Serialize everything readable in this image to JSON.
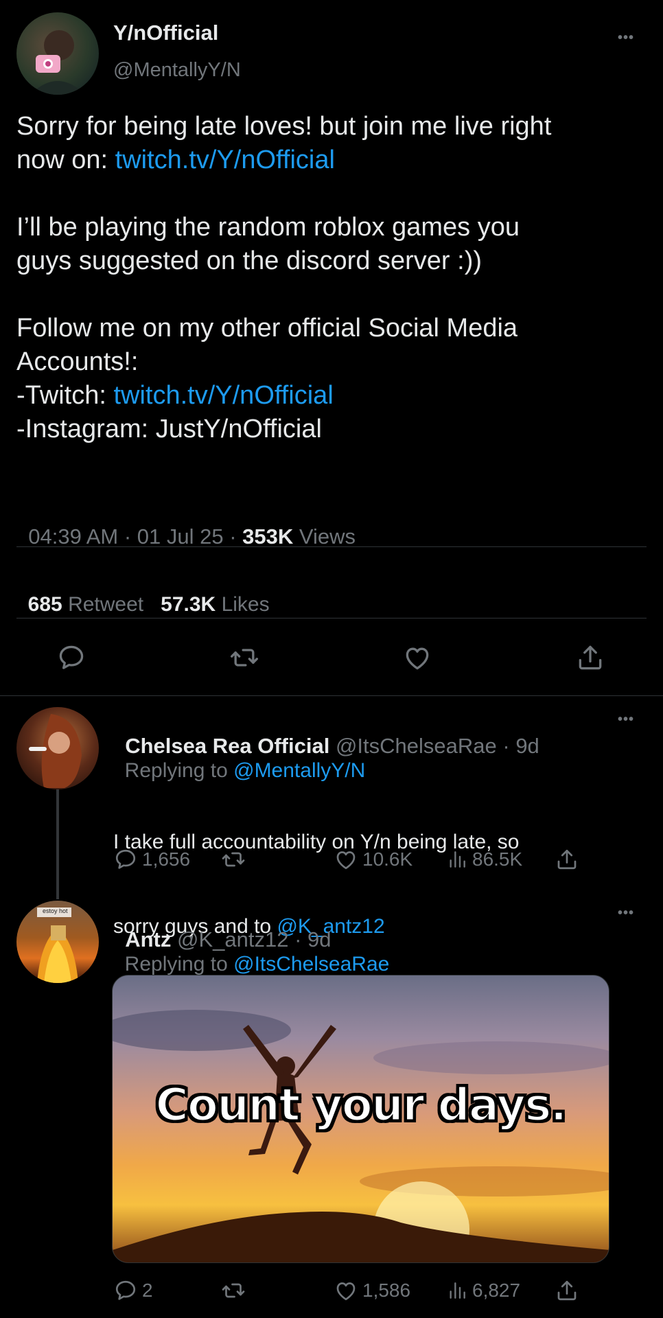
{
  "main_tweet": {
    "display_name": "Y/nOfficial",
    "handle": "@MentallyY/N",
    "text": {
      "l1a": "Sorry for being late loves! but join me live right",
      "l2a": "now on: ",
      "l2b": "twitch.tv/Y/nOfficial",
      "l3": "I’ll be playing the random roblox games you",
      "l4": "guys suggested on the discord server :))",
      "l5": "Follow me on my other official Social Media",
      "l6": "Accounts!:",
      "l7a": "-Twitch: ",
      "l7b": "twitch.tv/Y/nOfficial",
      "l8": "-Instagram: JustY/nOfficial"
    },
    "time": "04:39 AM",
    "date": "01 Jul 25",
    "views_count": "353K",
    "views_label": "Views",
    "retweet_count": "685",
    "retweet_label": "Retweet",
    "likes_count": "57.3K",
    "likes_label": "Likes"
  },
  "reply1": {
    "display_name": "Chelsea Rea Official",
    "handle": "@ItsChelseaRae",
    "age": "9d",
    "replying_prefix": "Replying to ",
    "replying_to": "@MentallyY/N",
    "text_l1": "I take full accountability on Y/n being late, so",
    "text_l2a": "sorry guys and to ",
    "text_l2b": "@K_antz12",
    "replies": "1,656",
    "likes": "10.6K",
    "views": "86.5K"
  },
  "reply2": {
    "display_name": "Antz",
    "handle": "@K_antz12",
    "age": "9d",
    "replying_prefix": "Replying to ",
    "replying_to": "@ItsChelseaRae",
    "avatar_caption": "estoy hot",
    "image_caption": "Count your days.",
    "replies": "2",
    "likes": "1,586",
    "views": "6,827"
  },
  "icons": [
    "more-icon",
    "reply-icon",
    "retweet-icon",
    "like-icon",
    "share-icon",
    "views-icon"
  ],
  "colors": {
    "background": "#000000",
    "text": "#e7e9ea",
    "muted": "#71767b",
    "link": "#1d9bf0",
    "divider": "#2f3336"
  }
}
